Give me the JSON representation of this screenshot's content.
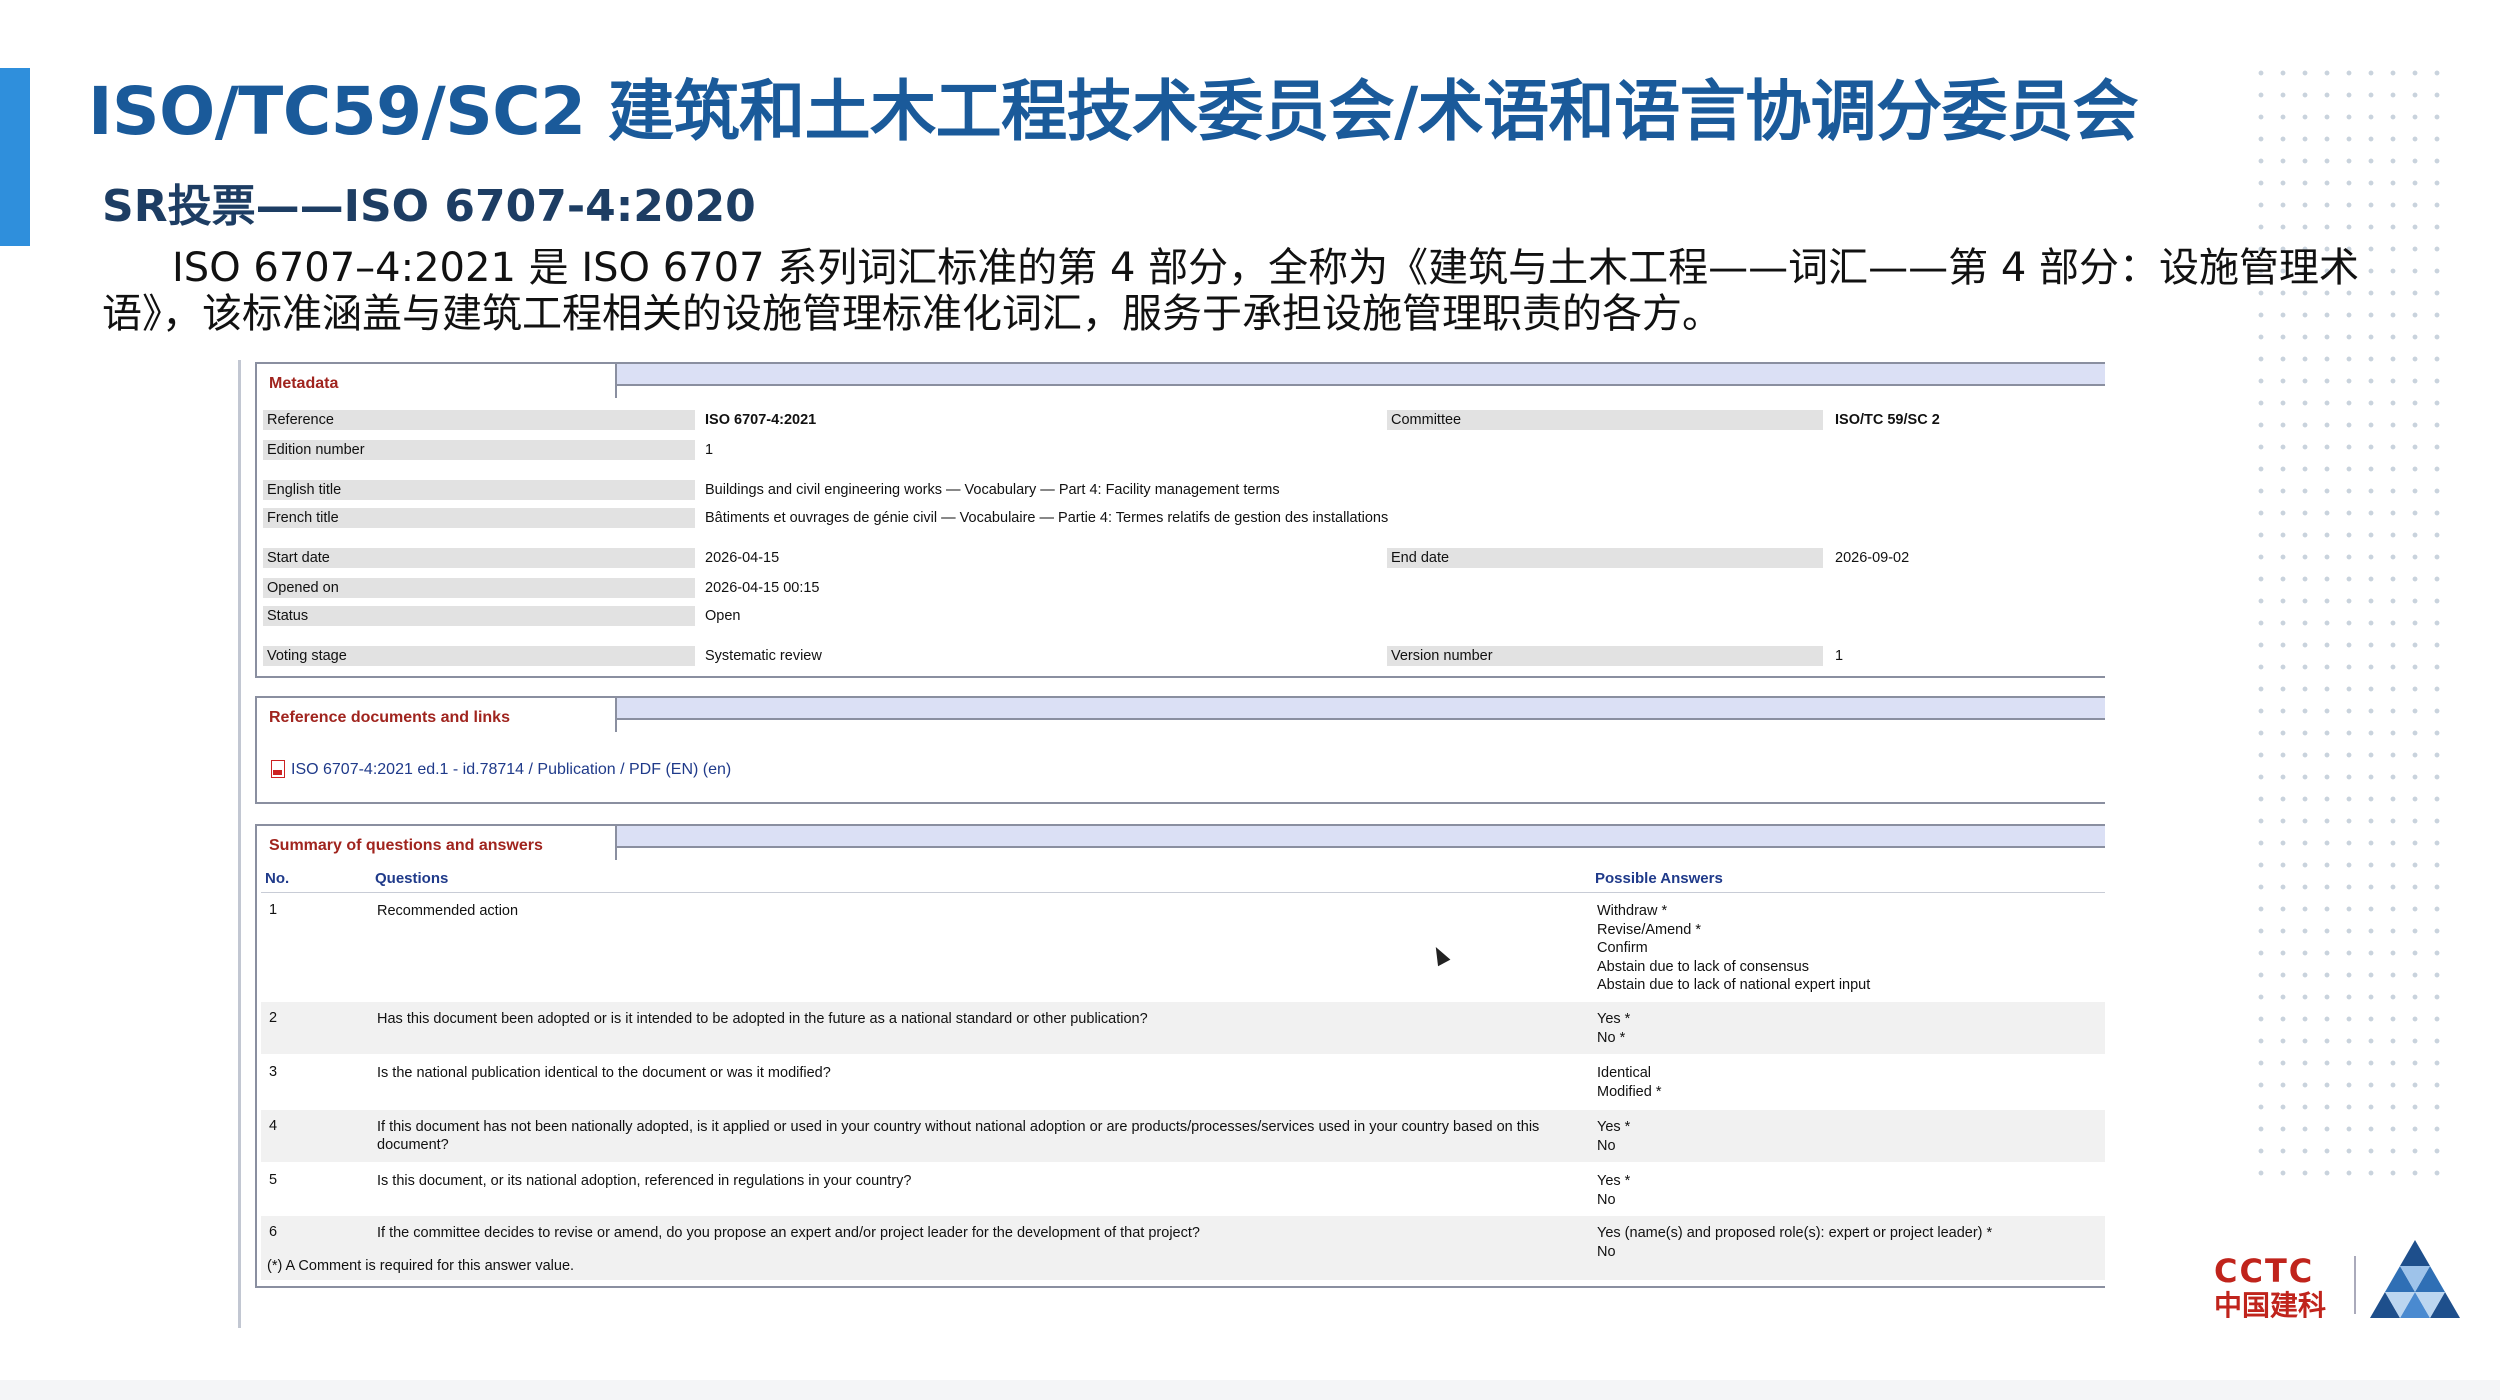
{
  "slide": {
    "title": "ISO/TC59/SC2 建筑和土木工程技术委员会/术语和语言协调分委员会",
    "subtitle": "SR投票——ISO 6707-4:2020",
    "paragraph": "ISO 6707–4:2021 是 ISO 6707 系列词汇标准的第 4 部分，全称为《建筑与土木工程——词汇——第 4 部分：设施管理术语》，该标准涵盖与建筑工程相关的设施管理标准化词汇，服务于承担设施管理职责的各方。"
  },
  "metadata": {
    "heading": "Metadata",
    "reference_label": "Reference",
    "reference_value": "ISO 6707-4:2021",
    "committee_label": "Committee",
    "committee_value": "ISO/TC 59/SC 2",
    "edition_label": "Edition number",
    "edition_value": "1",
    "english_title_label": "English title",
    "english_title_value": "Buildings and civil engineering works — Vocabulary — Part 4: Facility management terms",
    "french_title_label": "French title",
    "french_title_value": "Bâtiments et ouvrages de génie civil — Vocabulaire — Partie 4: Termes relatifs de gestion des installations",
    "start_date_label": "Start date",
    "start_date_value": "2026-04-15",
    "end_date_label": "End date",
    "end_date_value": "2026-09-02",
    "opened_on_label": "Opened on",
    "opened_on_value": "2026-04-15 00:15",
    "status_label": "Status",
    "status_value": "Open",
    "voting_stage_label": "Voting stage",
    "voting_stage_value": "Systematic review",
    "version_label": "Version number",
    "version_value": "1"
  },
  "references": {
    "heading": "Reference documents and links",
    "link_text": "ISO 6707-4:2021 ed.1 - id.78714 / Publication / PDF (EN) (en)"
  },
  "summary": {
    "heading": "Summary of questions and answers",
    "col_no": "No.",
    "col_questions": "Questions",
    "col_answers": "Possible Answers",
    "rows": [
      {
        "no": "1",
        "question": "Recommended action",
        "answers": [
          "Withdraw  *",
          "Revise/Amend  *",
          "Confirm",
          "Abstain due to lack of consensus",
          "Abstain due to lack of national expert input"
        ]
      },
      {
        "no": "2",
        "question": "Has this document been adopted or is it intended to be adopted in the future as a national standard or other publication?",
        "answers": [
          "Yes  *",
          "No  *"
        ]
      },
      {
        "no": "3",
        "question": "Is the national publication identical to the document or was it modified?",
        "answers": [
          "Identical",
          "Modified  *"
        ]
      },
      {
        "no": "4",
        "question": "If this document has not been nationally adopted, is it applied or used in your country without national adoption or are products/processes/services used in your country based on this document?",
        "answers": [
          "Yes  *",
          "No"
        ]
      },
      {
        "no": "5",
        "question": "Is this document, or its national adoption, referenced in regulations in your country?",
        "answers": [
          "Yes  *",
          "No"
        ]
      },
      {
        "no": "6",
        "question": "If the committee decides to revise or amend, do you propose an expert and/or project leader for the development of that project?",
        "answers": [
          "Yes (name(s) and proposed role(s): expert or project leader)  *",
          "No"
        ]
      }
    ],
    "footnote": "(*) A Comment is required for this answer value."
  },
  "logo": {
    "text": "CCTC",
    "subtext": "中国建科"
  },
  "colors": {
    "accent": "#2f8fdc",
    "title": "#1a5a9a",
    "section_heading": "#a0241e",
    "link": "#1f3a8a",
    "logo_red": "#c0241c",
    "logo_blue": "#1e4f8c"
  }
}
